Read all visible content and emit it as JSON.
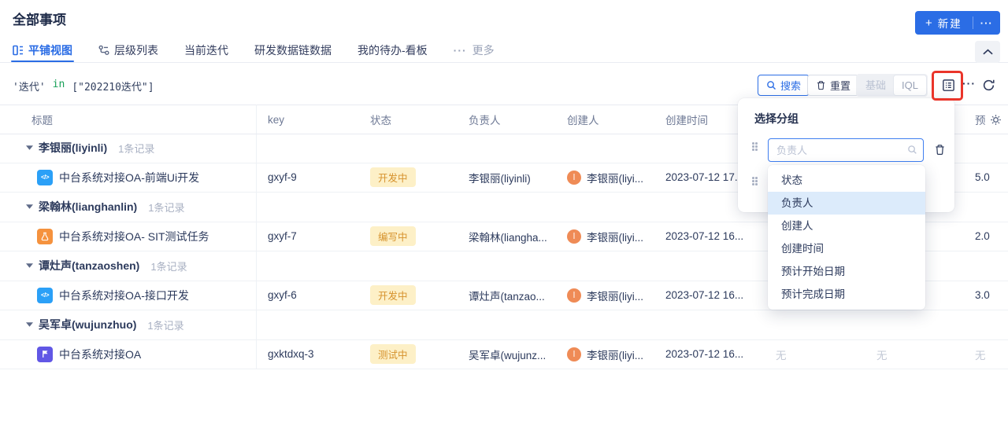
{
  "page_title": "全部事项",
  "header": {
    "new_plus": "+",
    "new_label": "新建",
    "new_more": "···"
  },
  "tabs": {
    "more_prefix": "···",
    "items": [
      {
        "label": "平铺视图"
      },
      {
        "label": "层级列表"
      },
      {
        "label": "当前迭代"
      },
      {
        "label": "研发数据链数据"
      },
      {
        "label": "我的待办-看板"
      },
      {
        "label": "更多"
      }
    ]
  },
  "toolbar": {
    "query": {
      "field": "'迭代'",
      "op": "in",
      "value": "[\"202210迭代\"]"
    },
    "search_label": "搜索",
    "reset_label": "重置",
    "mode_basic": "基础",
    "mode_iql": "IQL",
    "more_label": "···"
  },
  "icon_glyphs": {
    "dev": "</>"
  },
  "table": {
    "headers": {
      "title": "标题",
      "key": "key",
      "status": "状态",
      "assignee": "负责人",
      "creator": "创建人",
      "created": "创建时间",
      "estimate": "预"
    },
    "groups": [
      {
        "name": "李银丽(liyinli)",
        "count": "1条记录",
        "row": {
          "title": "中台系统对接OA-前端Ui开发",
          "key": "gxyf-9",
          "status": "开发中",
          "assignee": "李银丽(liyinli)",
          "avatar": "l",
          "creator": "李银丽(liyi...",
          "created": "2023-07-12 17...",
          "estimate": "5.0"
        }
      },
      {
        "name": "梁翰林(lianghanlin)",
        "count": "1条记录",
        "row": {
          "title": "中台系统对接OA- SIT测试任务",
          "key": "gxyf-7",
          "status": "编写中",
          "assignee": "梁翰林(liangha...",
          "avatar": "l",
          "creator": "李银丽(liyi...",
          "created": "2023-07-12 16...",
          "estimate": "2.0"
        }
      },
      {
        "name": "谭灶声(tanzaoshen)",
        "count": "1条记录",
        "row": {
          "title": "中台系统对接OA-接口开发",
          "key": "gxyf-6",
          "status": "开发中",
          "assignee": "谭灶声(tanzao...",
          "avatar": "l",
          "creator": "李银丽(liyi...",
          "created": "2023-07-12 16...",
          "estimate": "3.0"
        }
      },
      {
        "name": "吴军卓(wujunzhuo)",
        "count": "1条记录",
        "row": {
          "title": "中台系统对接OA",
          "key": "gxktdxq-3",
          "status": "测试中",
          "assignee": "吴军卓(wujunz...",
          "avatar": "l",
          "creator": "李银丽(liyi...",
          "created": "2023-07-12 16...",
          "c7": "无",
          "c8": "无",
          "estimate": "无"
        }
      }
    ]
  },
  "group_panel": {
    "title": "选择分组",
    "input_placeholder": "负责人",
    "options": [
      {
        "label": "状态"
      },
      {
        "label": "负责人"
      },
      {
        "label": "创建人"
      },
      {
        "label": "创建时间"
      },
      {
        "label": "预计开始日期"
      },
      {
        "label": "预计完成日期"
      }
    ]
  },
  "colors": {
    "primary_blue": "#2b6de5",
    "annotation_red": "#ea352a",
    "status_badge_bg": "#fdf0c7",
    "status_badge_text": "#d6922c",
    "avatar_orange": "#ef8b56",
    "dev_icon_blue": "#2ba0f7",
    "test_icon_orange": "#f5923e",
    "flag_icon_purple": "#6157e5",
    "in_keyword_green": "#18a058",
    "selected_option_bg": "#dcebfb"
  }
}
